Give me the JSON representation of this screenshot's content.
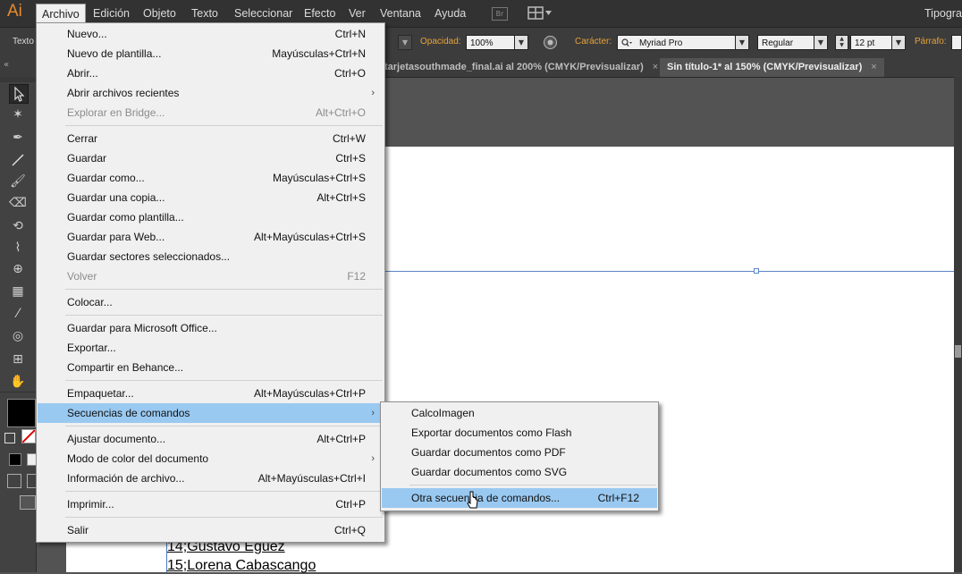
{
  "app": {
    "logo": "Ai",
    "workspace": "Tipografía"
  },
  "menubar": [
    "Archivo",
    "Edición",
    "Objeto",
    "Texto",
    "Seleccionar",
    "Efecto",
    "Ver",
    "Ventana",
    "Ayuda"
  ],
  "menubar_br": "Br",
  "control": {
    "tool_label": "Texto",
    "opacity_label": "Opacidad:",
    "opacity_value": "100%",
    "char_label": "Carácter:",
    "font_name": "Myriad Pro",
    "font_style": "Regular",
    "font_size": "12 pt",
    "para_label": "Párrafo:"
  },
  "tabs": [
    {
      "label": "tarjetasouthmade_final.ai al 200% (CMYK/Previsualizar)",
      "active": false
    },
    {
      "label": "Sin título-1* al 150% (CMYK/Previsualizar)",
      "active": true
    }
  ],
  "tab_close": "×",
  "file_menu": {
    "items": [
      {
        "label": "Nuevo...",
        "shortcut": "Ctrl+N"
      },
      {
        "label": "Nuevo de plantilla...",
        "shortcut": "Mayúsculas+Ctrl+N"
      },
      {
        "label": "Abrir...",
        "shortcut": "Ctrl+O"
      },
      {
        "label": "Abrir archivos recientes",
        "shortcut": "",
        "submenu": true
      },
      {
        "label": "Explorar en Bridge...",
        "shortcut": "Alt+Ctrl+O",
        "disabled": true
      },
      {
        "separator": true
      },
      {
        "label": "Cerrar",
        "shortcut": "Ctrl+W"
      },
      {
        "label": "Guardar",
        "shortcut": "Ctrl+S"
      },
      {
        "label": "Guardar como...",
        "shortcut": "Mayúsculas+Ctrl+S"
      },
      {
        "label": "Guardar una copia...",
        "shortcut": "Alt+Ctrl+S"
      },
      {
        "label": "Guardar como plantilla...",
        "shortcut": ""
      },
      {
        "label": "Guardar para Web...",
        "shortcut": "Alt+Mayúsculas+Ctrl+S"
      },
      {
        "label": "Guardar sectores seleccionados...",
        "shortcut": ""
      },
      {
        "label": "Volver",
        "shortcut": "F12",
        "disabled": true
      },
      {
        "separator": true
      },
      {
        "label": "Colocar...",
        "shortcut": ""
      },
      {
        "separator": true
      },
      {
        "label": "Guardar para Microsoft Office...",
        "shortcut": ""
      },
      {
        "label": "Exportar...",
        "shortcut": ""
      },
      {
        "label": "Compartir en Behance...",
        "shortcut": ""
      },
      {
        "separator": true
      },
      {
        "label": "Empaquetar...",
        "shortcut": "Alt+Mayúsculas+Ctrl+P"
      },
      {
        "label": "Secuencias de comandos",
        "shortcut": "",
        "submenu": true,
        "highlighted": true
      },
      {
        "separator": true
      },
      {
        "label": "Ajustar documento...",
        "shortcut": "Alt+Ctrl+P"
      },
      {
        "label": "Modo de color del documento",
        "shortcut": "",
        "submenu": true
      },
      {
        "label": "Información de archivo...",
        "shortcut": "Alt+Mayúsculas+Ctrl+I"
      },
      {
        "separator": true
      },
      {
        "label": "Imprimir...",
        "shortcut": "Ctrl+P"
      },
      {
        "separator": true
      },
      {
        "label": "Salir",
        "shortcut": "Ctrl+Q"
      }
    ]
  },
  "scripts_menu": {
    "items": [
      {
        "label": "CalcoImagen",
        "shortcut": ""
      },
      {
        "label": "Exportar documentos como Flash",
        "shortcut": ""
      },
      {
        "label": "Guardar documentos como PDF",
        "shortcut": ""
      },
      {
        "label": "Guardar documentos como SVG",
        "shortcut": ""
      },
      {
        "separator": true
      },
      {
        "label": "Otra secuencia de comandos...",
        "shortcut": "Ctrl+F12",
        "highlighted": true
      }
    ]
  },
  "document_lines": [
    "14;Gustavo Eguez",
    "15;Lorena Cabascango"
  ],
  "tools": [
    "selection-tool",
    "magic-wand-tool",
    "pen-tool",
    "line-tool",
    "brush-tool",
    "eraser-tool",
    "rotate-tool",
    "warp-tool",
    "shape-builder-tool",
    "mesh-tool",
    "eyedropper-tool",
    "symbol-sprayer-tool",
    "artboard-tool",
    "hand-tool"
  ]
}
